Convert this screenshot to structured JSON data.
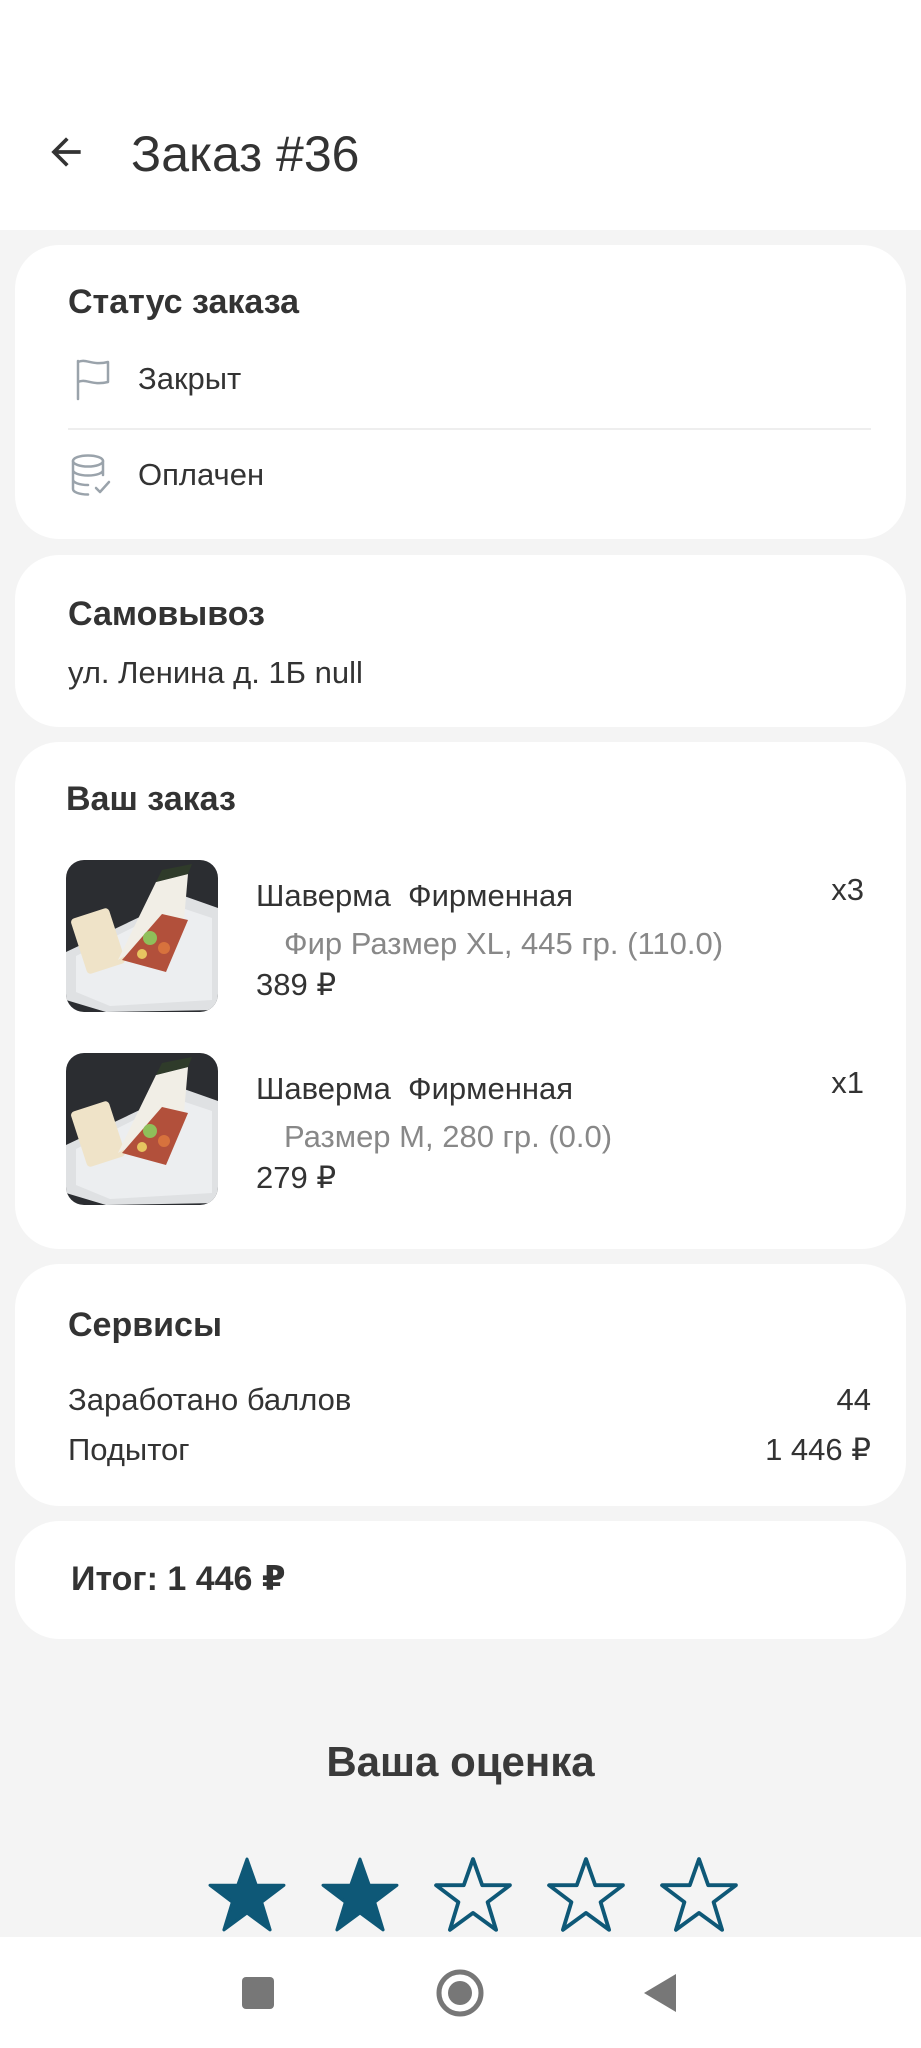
{
  "appbar": {
    "title": "Заказ #36",
    "back_icon": "arrow-left-icon"
  },
  "status": {
    "title": "Статус заказа",
    "state": {
      "icon": "flag-icon",
      "label": "Закрыт"
    },
    "payment": {
      "icon": "database-check-icon",
      "label": "Оплачен"
    }
  },
  "pickup": {
    "title": "Самовывоз",
    "address": "ул. Ленина д. 1Б null"
  },
  "order": {
    "title": "Ваш заказ",
    "items": [
      {
        "name": "Шаверма  Фирменная",
        "desc": "Фир Размер XL, 445 гр. (110.0)",
        "price": "389 ₽",
        "qty": "x3"
      },
      {
        "name": "Шаверма  Фирменная",
        "desc": "Размер M, 280 гр. (0.0)",
        "price": "279 ₽",
        "qty": "x1"
      }
    ]
  },
  "services": {
    "title": "Сервисы",
    "rows": [
      {
        "label": "Заработано баллов",
        "value": "44"
      },
      {
        "label": "Подытог",
        "value": "1 446 ₽"
      }
    ]
  },
  "total": {
    "text": "Итог: 1 446 ₽"
  },
  "rating": {
    "title": "Ваша оценка",
    "value": 2,
    "max": 5,
    "color": "#0e5877"
  },
  "navbar": {
    "icons": [
      "recents-icon",
      "home-icon",
      "back-icon"
    ]
  }
}
